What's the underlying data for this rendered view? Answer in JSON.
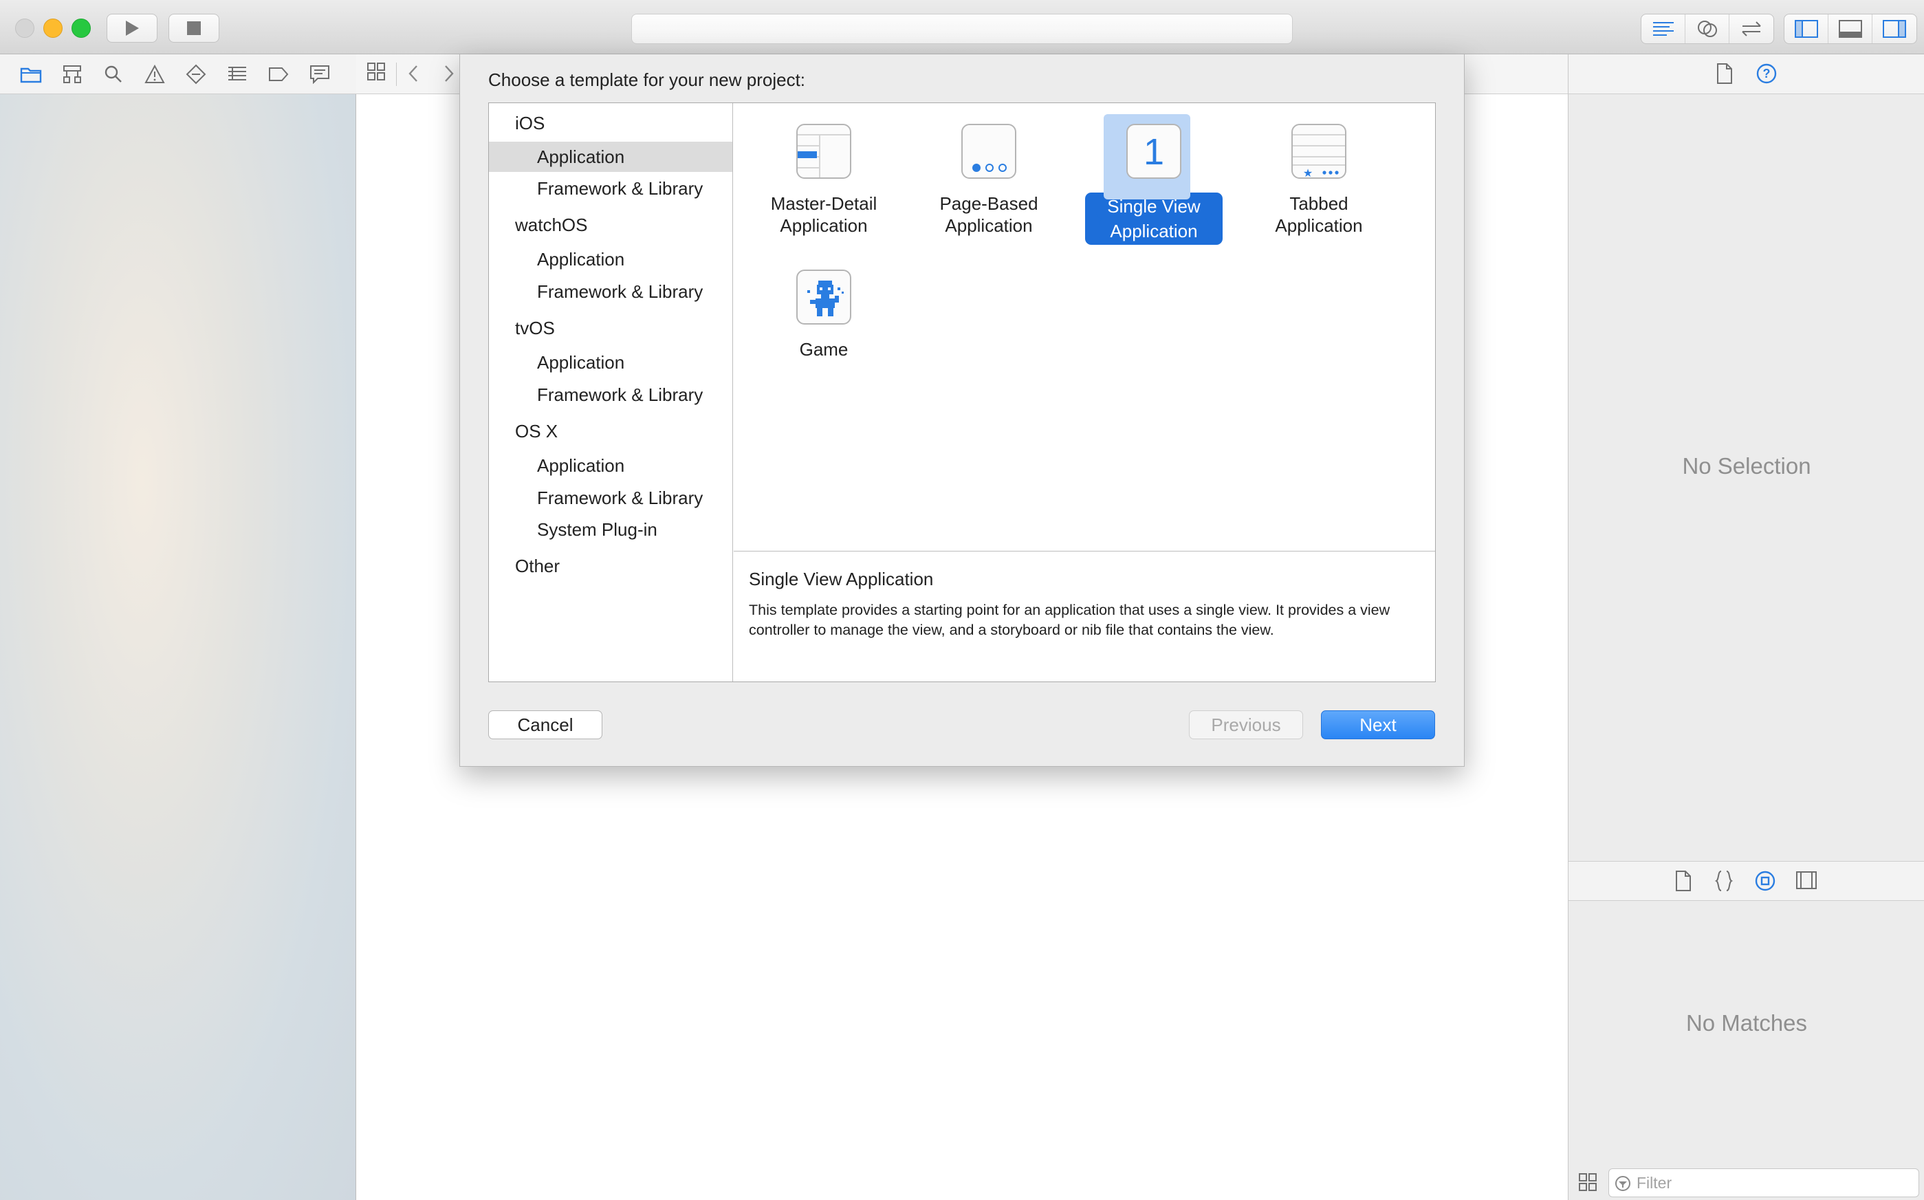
{
  "colors": {
    "accent": "#1d6ed9",
    "close": "#fc5f57",
    "minimize": "#fdbb2e",
    "zoom": "#27c840",
    "icon_blue": "#2a7de1",
    "icon_gray": "#6f6f6f"
  },
  "toolbar": {
    "run_icon": "play-icon",
    "stop_icon": "stop-icon",
    "editor_modes": [
      "standard-editor-icon",
      "assistant-editor-icon",
      "version-editor-icon"
    ],
    "view_toggles": [
      "navigator-toggle-icon",
      "debug-area-toggle-icon",
      "utilities-toggle-icon"
    ]
  },
  "navigator": {
    "tabs": [
      "folder-icon",
      "hierarchy-icon",
      "search-icon",
      "warning-icon",
      "test-icon",
      "debug-icon",
      "breakpoint-icon",
      "report-icon"
    ]
  },
  "dialog": {
    "title": "Choose a template for your new project:",
    "categories": [
      {
        "heading": "iOS",
        "items": [
          "Application",
          "Framework & Library"
        ]
      },
      {
        "heading": "watchOS",
        "items": [
          "Application",
          "Framework & Library"
        ]
      },
      {
        "heading": "tvOS",
        "items": [
          "Application",
          "Framework & Library"
        ]
      },
      {
        "heading": "OS X",
        "items": [
          "Application",
          "Framework & Library",
          "System Plug-in"
        ]
      },
      {
        "heading": "Other",
        "items": []
      }
    ],
    "selected_category": "iOS / Application",
    "templates": [
      {
        "label_line1": "Master-Detail",
        "label_line2": "Application",
        "icon": "master-detail-icon"
      },
      {
        "label_line1": "Page-Based",
        "label_line2": "Application",
        "icon": "page-based-icon"
      },
      {
        "label_line1": "Single View",
        "label_line2": "Application",
        "icon": "single-view-icon",
        "icon_text": "1"
      },
      {
        "label_line1": "Tabbed",
        "label_line2": "Application",
        "icon": "tabbed-icon"
      },
      {
        "label_line1": "Game",
        "label_line2": "",
        "icon": "game-icon"
      }
    ],
    "selected_template": "Single View Application",
    "description": {
      "title": "Single View Application",
      "text": "This template provides a starting point for an application that uses a single view. It provides a view controller to manage the view, and a storyboard or nib file that contains the view."
    },
    "buttons": {
      "cancel": "Cancel",
      "previous": "Previous",
      "next": "Next"
    }
  },
  "inspector": {
    "no_selection": "No Selection",
    "no_matches": "No Matches",
    "filter_placeholder": "Filter"
  }
}
